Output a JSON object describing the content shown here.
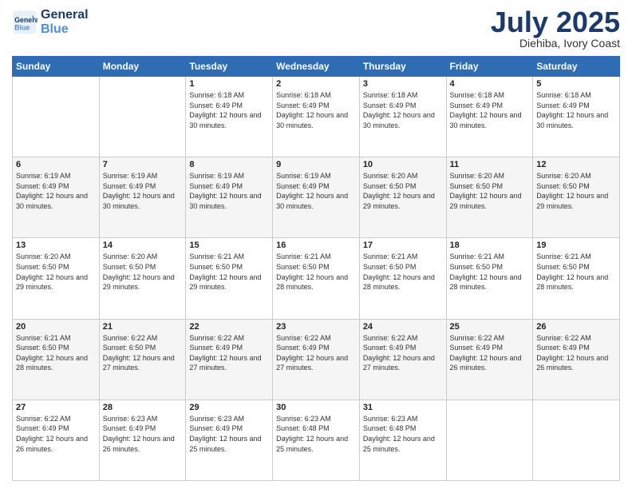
{
  "header": {
    "logo_general": "General",
    "logo_blue": "Blue",
    "month": "July 2025",
    "location": "Diehiba, Ivory Coast"
  },
  "days_of_week": [
    "Sunday",
    "Monday",
    "Tuesday",
    "Wednesday",
    "Thursday",
    "Friday",
    "Saturday"
  ],
  "weeks": [
    [
      {
        "day": "",
        "info": ""
      },
      {
        "day": "",
        "info": ""
      },
      {
        "day": "1",
        "info": "Sunrise: 6:18 AM\nSunset: 6:49 PM\nDaylight: 12 hours and 30 minutes."
      },
      {
        "day": "2",
        "info": "Sunrise: 6:18 AM\nSunset: 6:49 PM\nDaylight: 12 hours and 30 minutes."
      },
      {
        "day": "3",
        "info": "Sunrise: 6:18 AM\nSunset: 6:49 PM\nDaylight: 12 hours and 30 minutes."
      },
      {
        "day": "4",
        "info": "Sunrise: 6:18 AM\nSunset: 6:49 PM\nDaylight: 12 hours and 30 minutes."
      },
      {
        "day": "5",
        "info": "Sunrise: 6:18 AM\nSunset: 6:49 PM\nDaylight: 12 hours and 30 minutes."
      }
    ],
    [
      {
        "day": "6",
        "info": "Sunrise: 6:19 AM\nSunset: 6:49 PM\nDaylight: 12 hours and 30 minutes."
      },
      {
        "day": "7",
        "info": "Sunrise: 6:19 AM\nSunset: 6:49 PM\nDaylight: 12 hours and 30 minutes."
      },
      {
        "day": "8",
        "info": "Sunrise: 6:19 AM\nSunset: 6:49 PM\nDaylight: 12 hours and 30 minutes."
      },
      {
        "day": "9",
        "info": "Sunrise: 6:19 AM\nSunset: 6:49 PM\nDaylight: 12 hours and 30 minutes."
      },
      {
        "day": "10",
        "info": "Sunrise: 6:20 AM\nSunset: 6:50 PM\nDaylight: 12 hours and 29 minutes."
      },
      {
        "day": "11",
        "info": "Sunrise: 6:20 AM\nSunset: 6:50 PM\nDaylight: 12 hours and 29 minutes."
      },
      {
        "day": "12",
        "info": "Sunrise: 6:20 AM\nSunset: 6:50 PM\nDaylight: 12 hours and 29 minutes."
      }
    ],
    [
      {
        "day": "13",
        "info": "Sunrise: 6:20 AM\nSunset: 6:50 PM\nDaylight: 12 hours and 29 minutes."
      },
      {
        "day": "14",
        "info": "Sunrise: 6:20 AM\nSunset: 6:50 PM\nDaylight: 12 hours and 29 minutes."
      },
      {
        "day": "15",
        "info": "Sunrise: 6:21 AM\nSunset: 6:50 PM\nDaylight: 12 hours and 29 minutes."
      },
      {
        "day": "16",
        "info": "Sunrise: 6:21 AM\nSunset: 6:50 PM\nDaylight: 12 hours and 28 minutes."
      },
      {
        "day": "17",
        "info": "Sunrise: 6:21 AM\nSunset: 6:50 PM\nDaylight: 12 hours and 28 minutes."
      },
      {
        "day": "18",
        "info": "Sunrise: 6:21 AM\nSunset: 6:50 PM\nDaylight: 12 hours and 28 minutes."
      },
      {
        "day": "19",
        "info": "Sunrise: 6:21 AM\nSunset: 6:50 PM\nDaylight: 12 hours and 28 minutes."
      }
    ],
    [
      {
        "day": "20",
        "info": "Sunrise: 6:21 AM\nSunset: 6:50 PM\nDaylight: 12 hours and 28 minutes."
      },
      {
        "day": "21",
        "info": "Sunrise: 6:22 AM\nSunset: 6:50 PM\nDaylight: 12 hours and 27 minutes."
      },
      {
        "day": "22",
        "info": "Sunrise: 6:22 AM\nSunset: 6:49 PM\nDaylight: 12 hours and 27 minutes."
      },
      {
        "day": "23",
        "info": "Sunrise: 6:22 AM\nSunset: 6:49 PM\nDaylight: 12 hours and 27 minutes."
      },
      {
        "day": "24",
        "info": "Sunrise: 6:22 AM\nSunset: 6:49 PM\nDaylight: 12 hours and 27 minutes."
      },
      {
        "day": "25",
        "info": "Sunrise: 6:22 AM\nSunset: 6:49 PM\nDaylight: 12 hours and 26 minutes."
      },
      {
        "day": "26",
        "info": "Sunrise: 6:22 AM\nSunset: 6:49 PM\nDaylight: 12 hours and 26 minutes."
      }
    ],
    [
      {
        "day": "27",
        "info": "Sunrise: 6:22 AM\nSunset: 6:49 PM\nDaylight: 12 hours and 26 minutes."
      },
      {
        "day": "28",
        "info": "Sunrise: 6:23 AM\nSunset: 6:49 PM\nDaylight: 12 hours and 26 minutes."
      },
      {
        "day": "29",
        "info": "Sunrise: 6:23 AM\nSunset: 6:49 PM\nDaylight: 12 hours and 25 minutes."
      },
      {
        "day": "30",
        "info": "Sunrise: 6:23 AM\nSunset: 6:48 PM\nDaylight: 12 hours and 25 minutes."
      },
      {
        "day": "31",
        "info": "Sunrise: 6:23 AM\nSunset: 6:48 PM\nDaylight: 12 hours and 25 minutes."
      },
      {
        "day": "",
        "info": ""
      },
      {
        "day": "",
        "info": ""
      }
    ]
  ]
}
